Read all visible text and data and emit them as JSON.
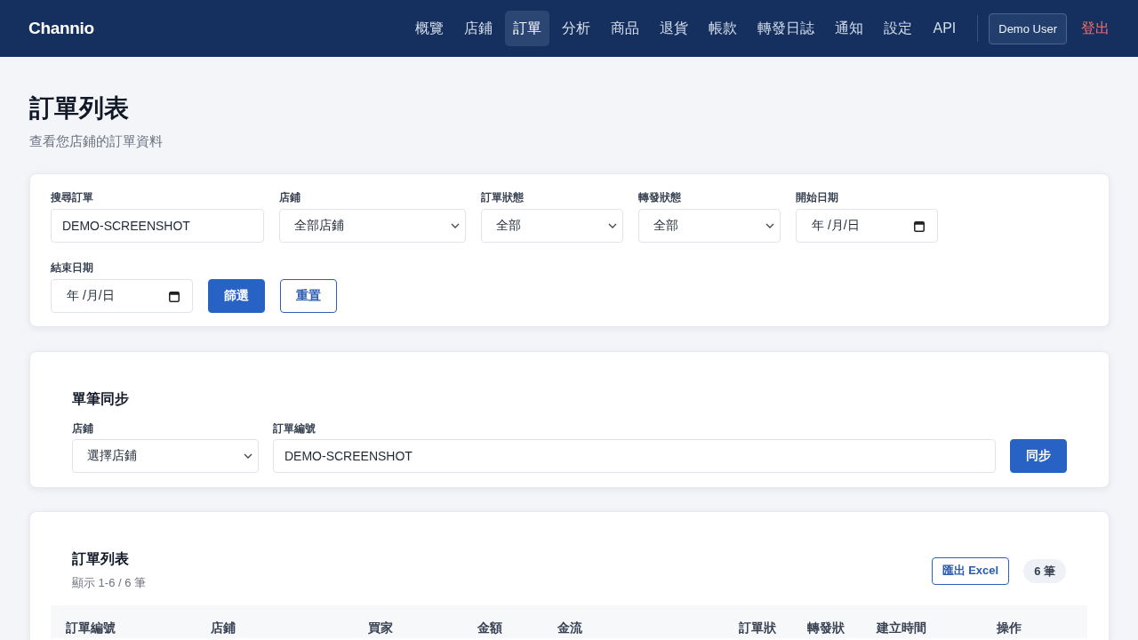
{
  "header": {
    "logo": "Channio",
    "nav": [
      {
        "label": "概覽",
        "selected": false
      },
      {
        "label": "店鋪",
        "selected": false
      },
      {
        "label": "訂單",
        "selected": true
      },
      {
        "label": "分析",
        "selected": false
      },
      {
        "label": "商品",
        "selected": false
      },
      {
        "label": "退貨",
        "selected": false
      },
      {
        "label": "帳款",
        "selected": false
      },
      {
        "label": "轉發日誌",
        "selected": false
      },
      {
        "label": "通知",
        "selected": false
      },
      {
        "label": "設定",
        "selected": false
      },
      {
        "label": "API",
        "selected": false
      }
    ],
    "user_button": "Demo User",
    "logout": "登出"
  },
  "page": {
    "title": "訂單列表",
    "subtitle": "查看您店鋪的訂單資料"
  },
  "filters": {
    "fields": [
      {
        "kind": "text",
        "label": "搜尋訂單",
        "value": "DEMO-SCREENSHOT"
      },
      {
        "kind": "select",
        "label": "店鋪",
        "value": "全部店鋪"
      },
      {
        "kind": "select",
        "label": "訂單狀態",
        "value": "全部"
      },
      {
        "kind": "select",
        "label": "轉發狀態",
        "value": "全部"
      },
      {
        "kind": "date",
        "label": "開始日期",
        "placeholder": "年 /月/日"
      },
      {
        "kind": "date",
        "label": "結束日期",
        "placeholder": "年 /月/日"
      }
    ],
    "buttons": [
      {
        "kind": "primary",
        "label": "篩選"
      },
      {
        "kind": "outline",
        "label": "重置"
      }
    ]
  },
  "sync": {
    "title": "單筆同步",
    "fields": [
      {
        "kind": "select",
        "label": "店鋪",
        "value": "選擇店鋪"
      },
      {
        "kind": "text",
        "label": "訂單編號",
        "value": "DEMO-SCREENSHOT"
      }
    ],
    "button": "同步"
  },
  "orders": {
    "title": "訂單列表",
    "summary": "顯示 1-6 / 6 筆",
    "export_button": "匯出 Excel",
    "count_badge": "6 筆",
    "columns": [
      "訂單編號",
      "店鋪",
      "買家",
      "金額",
      "金流",
      "訂單狀",
      "轉發狀",
      "建立時間",
      "操作"
    ]
  }
}
